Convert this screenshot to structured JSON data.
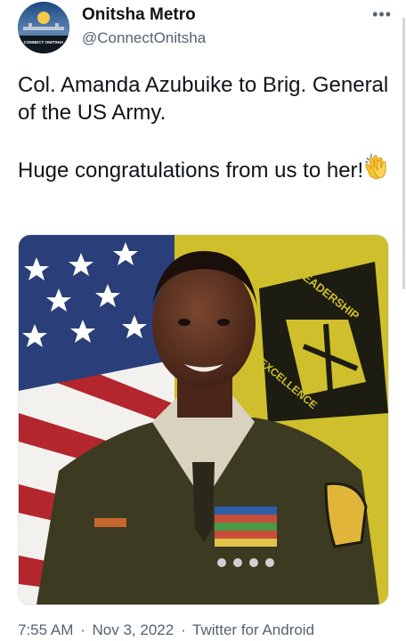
{
  "account": {
    "name": "Onitsha Metro",
    "handle": "@ConnectOnitsha",
    "avatar_text": "CONNECT ONITSHA"
  },
  "menu": {
    "more_label": "•••"
  },
  "tweet": {
    "line1": "Col. Amanda Azubuike to Brig. General of the US Army.",
    "line2": "Huge congratulations from us to her!",
    "emoji": "clapping-hands-icon"
  },
  "media": {
    "patch_text_top": "LEADERSHIP",
    "patch_text_bottom": "EXCELLENCE"
  },
  "meta": {
    "time": "7:55 AM",
    "date": "Nov 3, 2022",
    "source": "Twitter for Android",
    "separator": "·"
  },
  "colors": {
    "accent": "#1d9bf0",
    "text": "#0f1419",
    "muted": "#536471",
    "uniform": "#3d3a22",
    "flag_blue": "#2a3f7a",
    "flag_red": "#b3262d",
    "banner_yellow": "#d3c12d"
  }
}
